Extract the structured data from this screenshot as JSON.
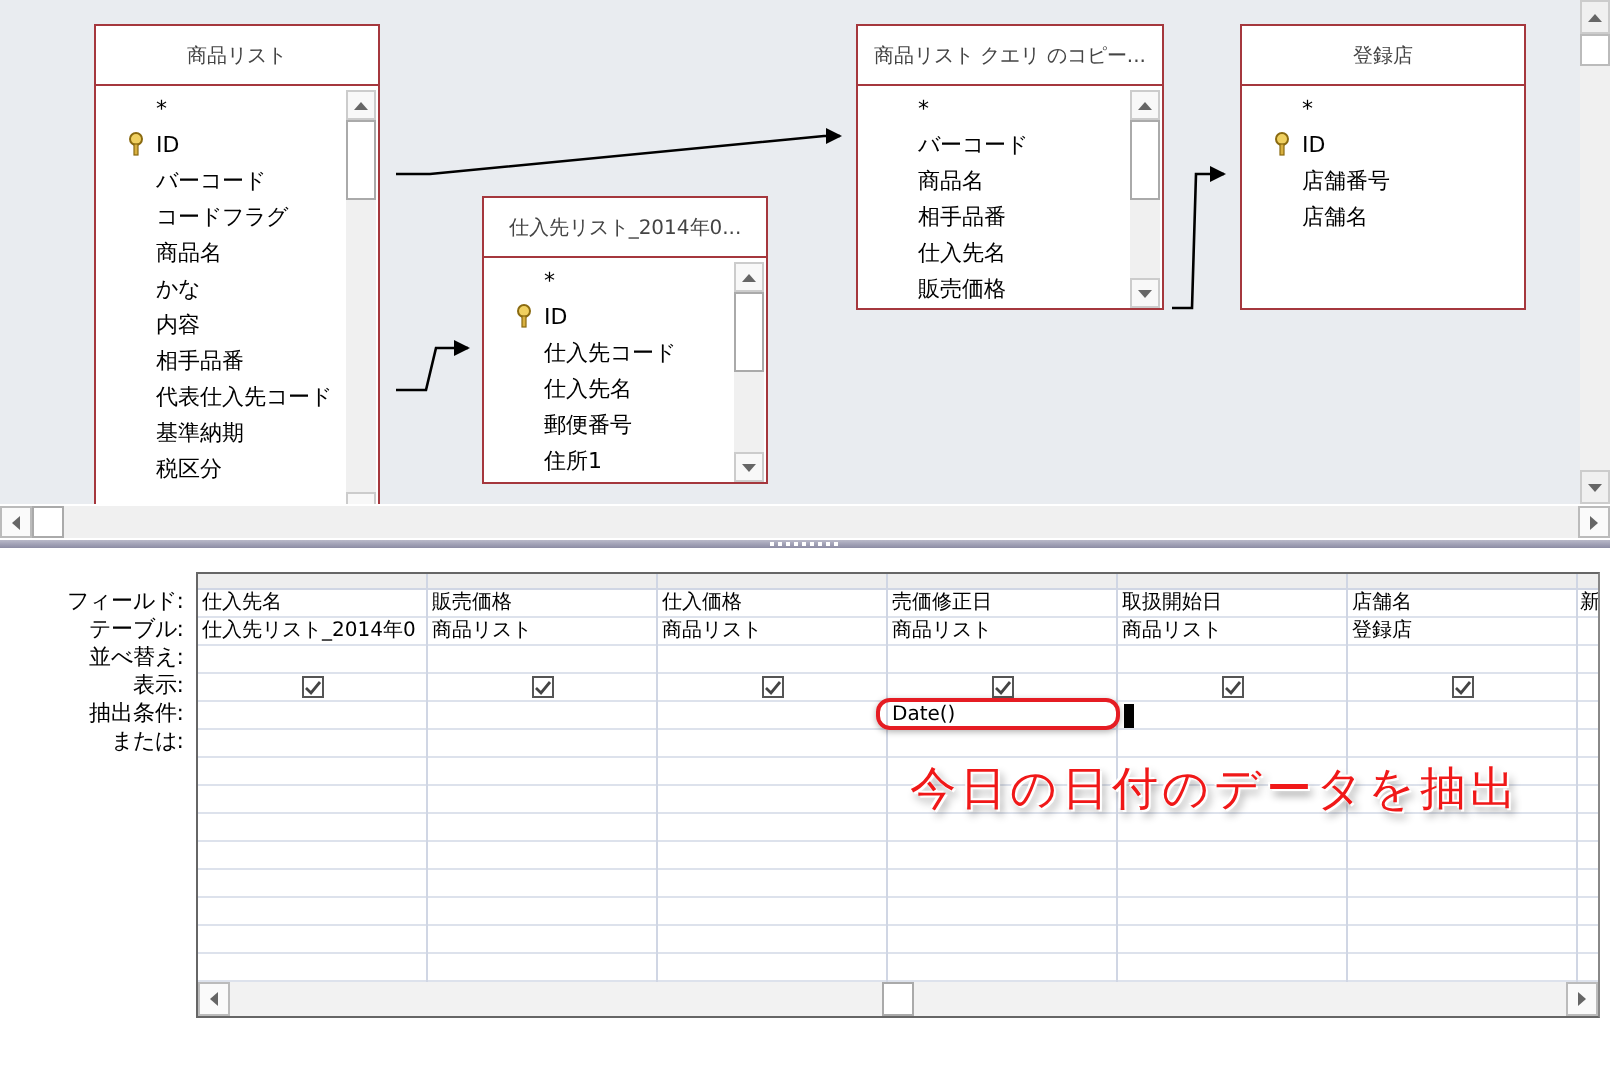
{
  "tables": [
    {
      "title": "商品リスト",
      "scrollable": true,
      "fields": [
        {
          "name": "*",
          "key": false
        },
        {
          "name": "ID",
          "key": true
        },
        {
          "name": "バーコード",
          "key": false
        },
        {
          "name": "コードフラグ",
          "key": false
        },
        {
          "name": "商品名",
          "key": false
        },
        {
          "name": "かな",
          "key": false
        },
        {
          "name": "内容",
          "key": false
        },
        {
          "name": "相手品番",
          "key": false
        },
        {
          "name": "代表仕入先コード",
          "key": false
        },
        {
          "name": "基準納期",
          "key": false
        },
        {
          "name": "税区分",
          "key": false
        }
      ]
    },
    {
      "title": "仕入先リスト_2014年0...",
      "scrollable": true,
      "fields": [
        {
          "name": "*",
          "key": false
        },
        {
          "name": "ID",
          "key": true
        },
        {
          "name": "仕入先コード",
          "key": false
        },
        {
          "name": "仕入先名",
          "key": false
        },
        {
          "name": "郵便番号",
          "key": false
        },
        {
          "name": "住所1",
          "key": false
        }
      ]
    },
    {
      "title": "商品リスト クエリ のコピー...",
      "scrollable": true,
      "fields": [
        {
          "name": "*",
          "key": false
        },
        {
          "name": "バーコード",
          "key": false
        },
        {
          "name": "商品名",
          "key": false
        },
        {
          "name": "相手品番",
          "key": false
        },
        {
          "name": "仕入先名",
          "key": false
        },
        {
          "name": "販売価格",
          "key": false
        }
      ]
    },
    {
      "title": "登録店",
      "scrollable": false,
      "fields": [
        {
          "name": "*",
          "key": false
        },
        {
          "name": "ID",
          "key": true
        },
        {
          "name": "店舗番号",
          "key": false
        },
        {
          "name": "店舗名",
          "key": false
        }
      ]
    }
  ],
  "grid": {
    "row_labels": [
      "フィールド:",
      "テーブル:",
      "並べ替え:",
      "表示:",
      "抽出条件:",
      "または:"
    ],
    "columns": [
      {
        "field": "仕入先名",
        "table": "仕入先リスト_2014年0",
        "show": true,
        "highlighted": false
      },
      {
        "field": "販売価格",
        "table": "商品リスト",
        "show": true,
        "highlighted": false
      },
      {
        "field": "仕入価格",
        "table": "商品リスト",
        "show": true,
        "highlighted": false
      },
      {
        "field": "売価修正日",
        "table": "商品リスト",
        "show": true,
        "criteria": "Date()",
        "highlighted": true
      },
      {
        "field": "取扱開始日",
        "table": "商品リスト",
        "show": true,
        "highlighted": false
      },
      {
        "field": "店舗名",
        "table": "登録店",
        "show": true,
        "highlighted": false
      },
      {
        "field": "新",
        "show": false,
        "highlighted": false
      }
    ]
  },
  "annotation": {
    "text": "今日の日付のデータを抽出"
  }
}
